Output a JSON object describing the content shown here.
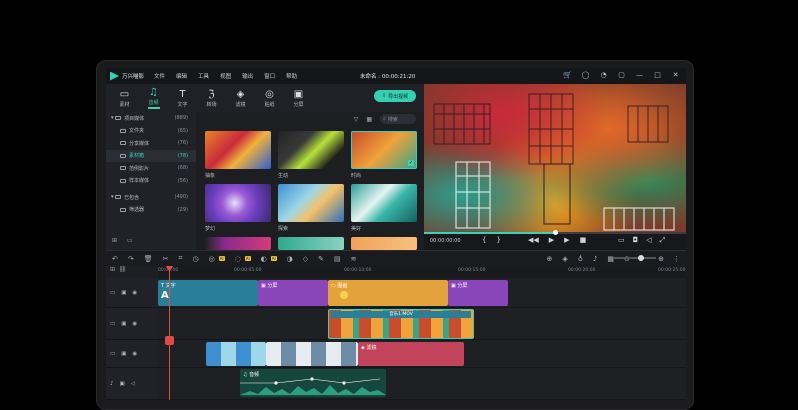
{
  "titlebar": {
    "app_name": "万兴喵影",
    "menus": [
      "文件",
      "编辑",
      "工具",
      "视图",
      "输出",
      "窗口",
      "帮助"
    ],
    "project_title": "未命名 : 00:00:21:20"
  },
  "media_tabs": [
    {
      "label": "素材",
      "icon": "folder-icon"
    },
    {
      "label": "音频",
      "icon": "music-icon"
    },
    {
      "label": "文字",
      "icon": "text-icon"
    },
    {
      "label": "转场",
      "icon": "transition-icon"
    },
    {
      "label": "滤镜",
      "icon": "filter-icon"
    },
    {
      "label": "贴纸",
      "icon": "sticker-icon"
    },
    {
      "label": "分屏",
      "icon": "split-screen-icon"
    }
  ],
  "export_label": "导出视频",
  "folders": [
    {
      "label": "项目媒体",
      "count": "(889)"
    },
    {
      "label": "文件夹",
      "count": "(65)"
    },
    {
      "label": "分享媒体",
      "count": "(76)"
    },
    {
      "label": "素材箱",
      "count": "(78)"
    },
    {
      "label": "范例影片",
      "count": "(68)"
    },
    {
      "label": "样本媒体",
      "count": "(56)"
    },
    {
      "label": "已包含",
      "count": "(490)"
    },
    {
      "label": "筛选器",
      "count": "(29)"
    }
  ],
  "search_placeholder": "搜索",
  "media_items": [
    {
      "label": "抽象"
    },
    {
      "label": "生动"
    },
    {
      "label": "时尚"
    },
    {
      "label": "梦幻"
    },
    {
      "label": "探索"
    },
    {
      "label": "美好"
    }
  ],
  "preview": {
    "timecode": "00:00:00:00",
    "progress": 0.5
  },
  "timeline": {
    "ruler_ticks": [
      "00:00:00",
      "00:00:05:00",
      "00:00:10:00",
      "00:00:15:00",
      "00:00:20:00",
      "00:00:25:00"
    ],
    "clips": {
      "text": "文字",
      "split1": "分屏",
      "pip": "图画",
      "split2": "分屏",
      "music_bg": "音乐1.MOV",
      "filter": "滤镜",
      "audio": "音频"
    }
  }
}
